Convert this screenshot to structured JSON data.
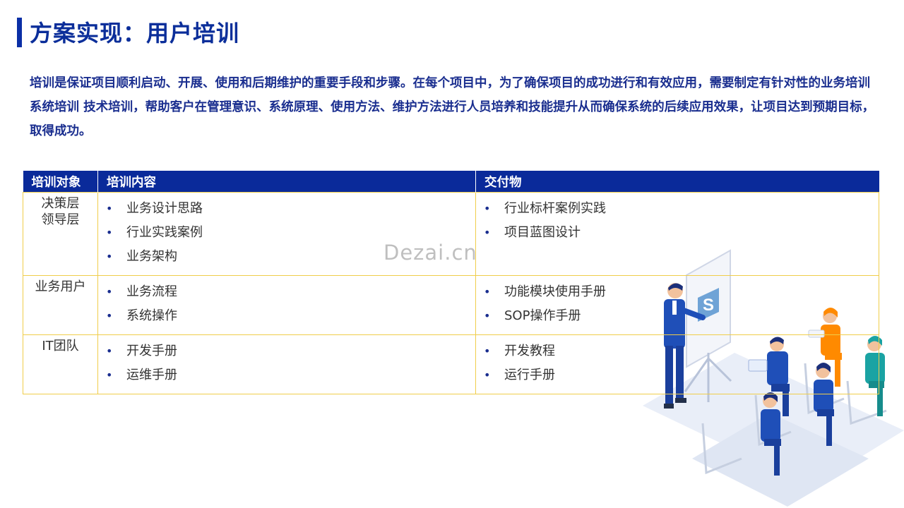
{
  "header": {
    "title": "方案实现：用户培训"
  },
  "intro": "培训是保证项目顺利启动、开展、使用和后期维护的重要手段和步骤。在每个项目中，为了确保项目的成功进行和有效应用，需要制定有针对性的业务培训 系统培训 技术培训，帮助客户在管理意识、系统原理、使用方法、维护方法进行人员培养和技能提升从而确保系统的后续应用效果，让项目达到预期目标，取得成功。",
  "table": {
    "headers": [
      "培训对象",
      "培训内容",
      "交付物"
    ],
    "rows": [
      {
        "target": [
          "决策层",
          "领导层"
        ],
        "content": [
          "业务设计思路",
          "行业实践案例",
          "业务架构"
        ],
        "deliverables": [
          "行业标杆案例实践",
          "项目蓝图设计"
        ]
      },
      {
        "target": [
          "业务用户"
        ],
        "content": [
          "业务流程",
          "系统操作"
        ],
        "deliverables": [
          "功能模块使用手册",
          "SOP操作手册"
        ]
      },
      {
        "target": [
          "IT团队"
        ],
        "content": [
          "开发手册",
          "运维手册"
        ],
        "deliverables": [
          "开发教程",
          "运行手册"
        ]
      }
    ]
  },
  "watermark": "Dezai.cn",
  "colors": {
    "primary": "#0a2a9a",
    "border": "#f0cd4a",
    "accent": "#ff8a00"
  },
  "icons": {
    "board_logo": "s-logo-icon"
  }
}
